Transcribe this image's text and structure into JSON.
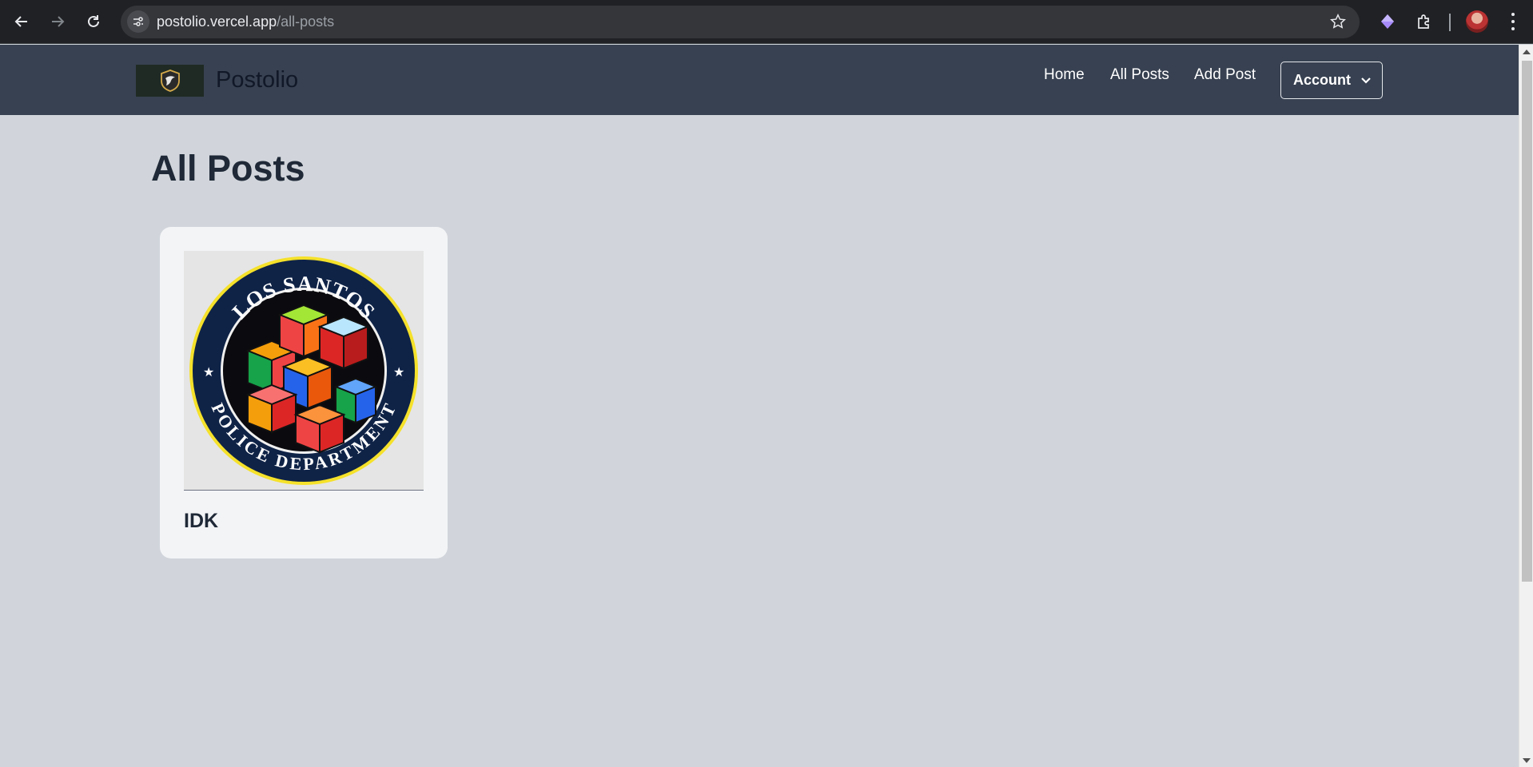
{
  "browser": {
    "url_host": "postolio.vercel.app",
    "url_path": "/all-posts"
  },
  "site": {
    "brand": "Postolio",
    "nav": {
      "home": "Home",
      "all_posts": "All Posts",
      "add_post": "Add Post",
      "account": "Account"
    }
  },
  "page": {
    "title": "All Posts",
    "posts": [
      {
        "title": "IDK",
        "image": {
          "top_text": "LOS SANTOS",
          "bottom_text": "POLICE DEPARTMENT"
        }
      }
    ]
  },
  "colors": {
    "navbar": "#374151",
    "page_bg": "#d1d5db",
    "card_bg": "#f3f4f6",
    "text_dark": "#1f2937",
    "seal_ring": "#0f2347",
    "seal_border": "#f5e12a"
  },
  "icons": [
    "back-icon",
    "forward-icon",
    "reload-icon",
    "site-info-icon",
    "star-icon",
    "extension-gem-icon",
    "puzzle-icon",
    "chevron-down-icon"
  ]
}
